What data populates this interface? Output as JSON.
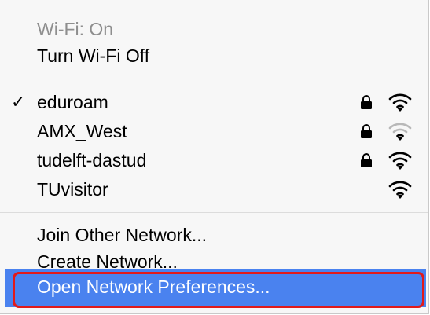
{
  "wifi_status": {
    "status_label": "Wi-Fi: On",
    "toggle_label": "Turn Wi-Fi Off"
  },
  "networks": [
    {
      "name": "eduroam",
      "selected": true,
      "locked": true,
      "signal": "strong"
    },
    {
      "name": "AMX_West",
      "selected": false,
      "locked": true,
      "signal": "weak"
    },
    {
      "name": "tudelft-dastud",
      "selected": false,
      "locked": true,
      "signal": "strong"
    },
    {
      "name": "TUvisitor",
      "selected": false,
      "locked": false,
      "signal": "strong"
    }
  ],
  "actions": {
    "join_other": "Join Other Network...",
    "create_network": "Create Network...",
    "open_preferences": "Open Network Preferences..."
  },
  "colors": {
    "highlight": "#4a82ef",
    "annotation_border": "#e21a1a"
  },
  "icons": {
    "checkmark": "checkmark-icon",
    "lock": "lock-icon",
    "wifi": "wifi-signal-icon"
  }
}
